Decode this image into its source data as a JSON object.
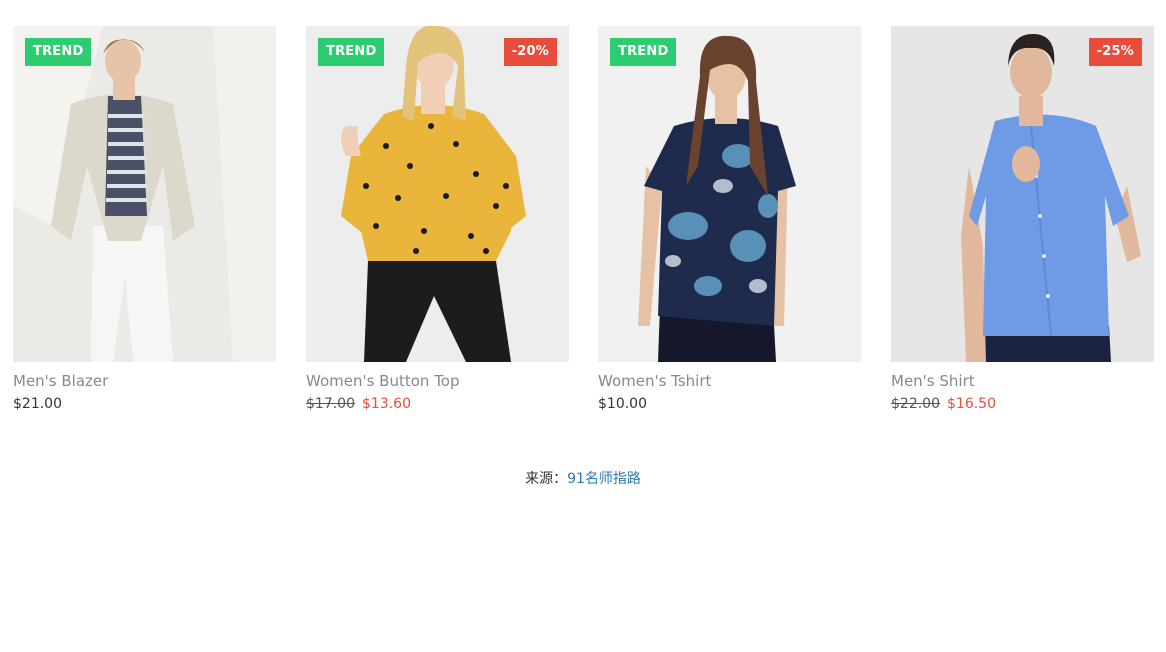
{
  "products": [
    {
      "name": "Men's Blazer",
      "price": "$21.00",
      "badges": {
        "trend": "TREND"
      },
      "photo": {
        "background": "#eceae6",
        "top_color": "#dcd8cc",
        "shirt_color": "#4a5066",
        "pants_color": "#f4f4f2",
        "skin": "#e7c4a8",
        "hair": "#9a6e46"
      }
    },
    {
      "name": "Women's Button Top",
      "old_price": "$17.00",
      "price": "$13.60",
      "badges": {
        "trend": "TREND",
        "sale": "-20%"
      },
      "photo": {
        "background": "#ededed",
        "top_color": "#e9b53a",
        "pants_color": "#1c1c1e",
        "skin": "#f1cfb6",
        "hair": "#e3c27a"
      }
    },
    {
      "name": "Women's Tshirt",
      "price": "$10.00",
      "badges": {
        "trend": "TREND"
      },
      "photo": {
        "background": "#f1f1f1",
        "top_color": "#1f2b4d",
        "accent": "#5f9bc3",
        "pants_color": "#15182a",
        "skin": "#e6c1a4",
        "hair": "#6a4330"
      }
    },
    {
      "name": "Men's Shirt",
      "old_price": "$22.00",
      "price": "$16.50",
      "badges": {
        "sale": "-25%"
      },
      "photo": {
        "background": "#e6e6e6",
        "top_color": "#6f9be6",
        "pants_color": "#1c2340",
        "skin": "#e2b89c",
        "hair": "#2b2220"
      }
    }
  ],
  "footer": {
    "source_label": "来源：",
    "source_link": "91名师指路"
  },
  "colors": {
    "trend_badge": "#2ecc71",
    "sale_badge": "#e74c3c",
    "sale_price": "#e74c3c",
    "link": "#2a7ab0"
  }
}
